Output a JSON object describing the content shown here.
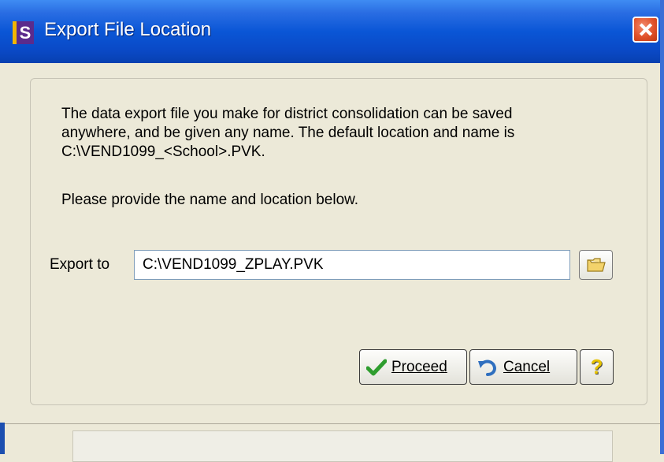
{
  "window": {
    "title": "Export File Location",
    "app_icon_letter": "S"
  },
  "dialog": {
    "description": "The data export file you make for district consolidation can be saved\nanywhere, and be given any name.  The default location and name is\nC:\\VEND1099_<School>.PVK.",
    "prompt": "Please provide the name and location below.",
    "export_label": "Export to",
    "export_value": "C:\\VEND1099_ZPLAY.PVK"
  },
  "buttons": {
    "proceed": "Proceed",
    "cancel": "Cancel",
    "help": "?"
  },
  "icons": {
    "app": "app-s-icon",
    "close": "close-icon",
    "folder": "folder-icon",
    "checkmark": "checkmark-icon",
    "undo": "undo-arrow-icon",
    "help": "question-mark-icon"
  },
  "colors": {
    "titlebar": "#0a56d6",
    "dialog_bg": "#ece9d8",
    "close_button": "#e0512a"
  }
}
